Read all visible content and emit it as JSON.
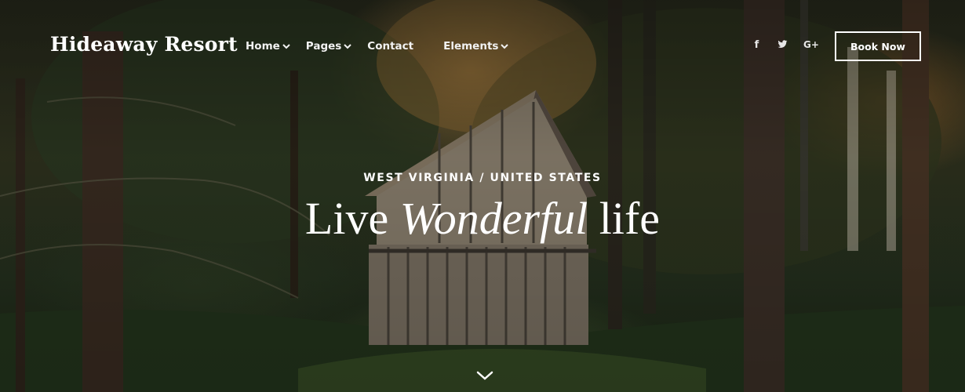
{
  "header": {
    "brand": "Hideaway Resort",
    "nav": [
      {
        "label": "Home",
        "has_dropdown": true
      },
      {
        "label": "Pages",
        "has_dropdown": true
      },
      {
        "label": "Contact",
        "has_dropdown": false
      },
      {
        "label": "Elements",
        "has_dropdown": true
      }
    ],
    "social": [
      {
        "icon": "facebook-icon",
        "glyph": "f"
      },
      {
        "icon": "twitter-icon",
        "glyph": "🐦"
      },
      {
        "icon": "google-plus-icon",
        "glyph": "G+"
      }
    ],
    "cta_label": "Book Now"
  },
  "hero": {
    "kicker": "WEST VIRGINIA / UNITED STATES",
    "headline_part1": "Live ",
    "headline_emphasis": "Wonderful",
    "headline_part2": " life",
    "scroll_icon": "chevron-down-icon"
  },
  "colors": {
    "text": "#ffffff",
    "overlay": "#000000"
  }
}
